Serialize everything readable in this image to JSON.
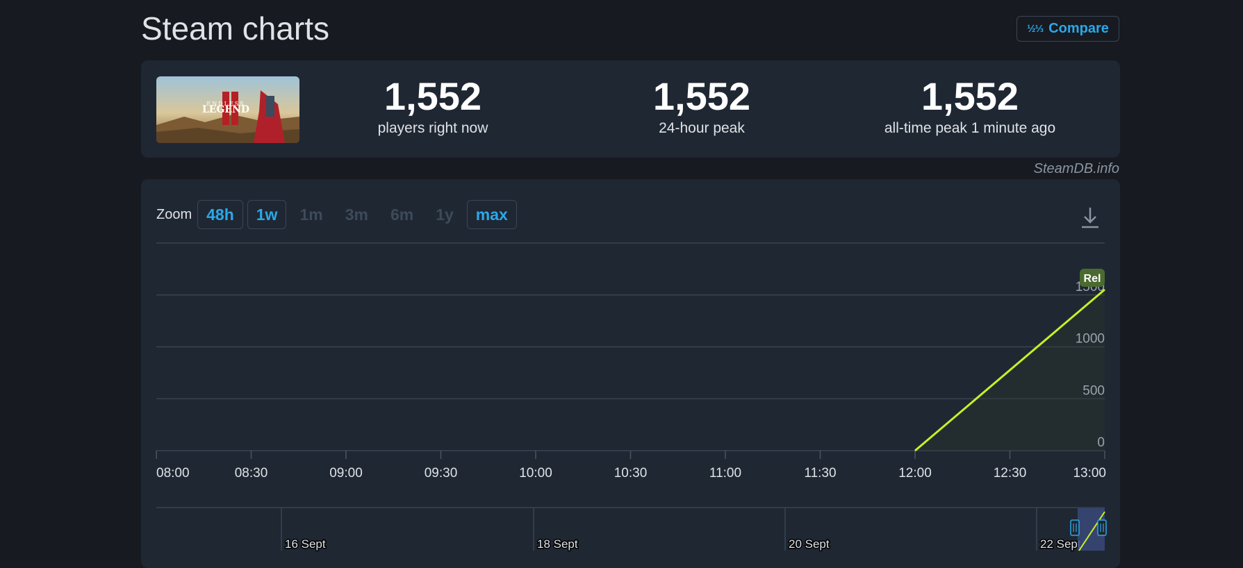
{
  "page": {
    "title": "Steam charts"
  },
  "compare": {
    "icon": "½⅓",
    "label": "Compare"
  },
  "game": {
    "thumbnail_text_top": "ENDLESS",
    "thumbnail_text_main": "LEGEND"
  },
  "stats": [
    {
      "value": "1,552",
      "label": "players right now"
    },
    {
      "value": "1,552",
      "label": "24-hour peak"
    },
    {
      "value": "1,552",
      "label": "all-time peak 1 minute ago"
    }
  ],
  "watermark": "SteamDB.info",
  "zoom": {
    "label": "Zoom",
    "options": [
      {
        "label": "48h",
        "enabled": true
      },
      {
        "label": "1w",
        "enabled": true
      },
      {
        "label": "1m",
        "enabled": false
      },
      {
        "label": "3m",
        "enabled": false
      },
      {
        "label": "6m",
        "enabled": false
      },
      {
        "label": "1y",
        "enabled": false
      },
      {
        "label": "max",
        "enabled": true
      }
    ],
    "download_icon": "download-icon"
  },
  "chart_data": {
    "type": "line",
    "x": [
      "12:00",
      "13:00"
    ],
    "series": [
      {
        "values": [
          0,
          1552
        ],
        "color": "#c6f127"
      }
    ],
    "x_ticks": [
      "08:00",
      "08:30",
      "09:00",
      "09:30",
      "10:00",
      "10:30",
      "11:00",
      "11:30",
      "12:00",
      "12:30",
      "13:00"
    ],
    "y_ticks": [
      0,
      500,
      1000,
      1500
    ],
    "ylim": [
      0,
      2000
    ],
    "xlim": [
      "08:00",
      "13:00"
    ],
    "annotation": "Rel",
    "grid": true,
    "navigator_labels": [
      "16 Sept",
      "18 Sept",
      "20 Sept",
      "22 Sept"
    ]
  },
  "colors": {
    "background": "#171a21",
    "panel": "#1f2733",
    "accent": "#2ba8e8",
    "line": "#c6f127",
    "annotation": "#4b6a2f"
  }
}
